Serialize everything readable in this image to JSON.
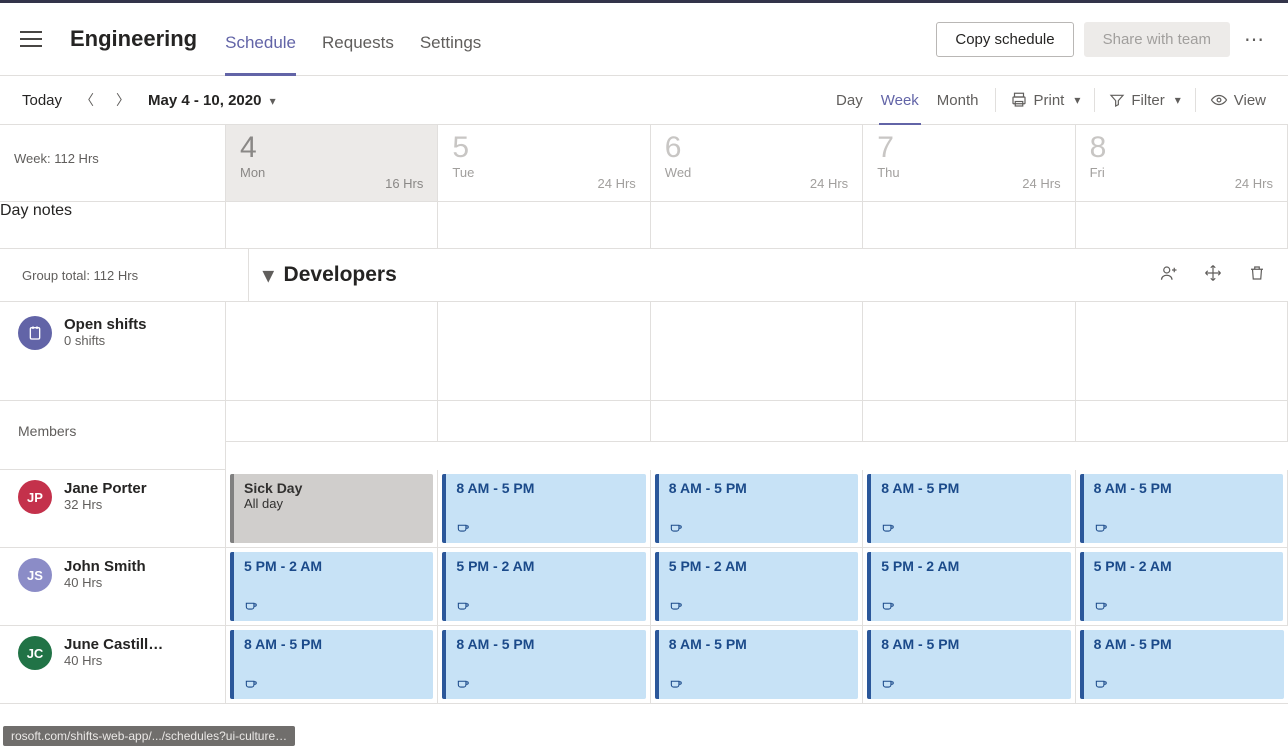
{
  "header": {
    "team": "Engineering",
    "tabs": [
      "Schedule",
      "Requests",
      "Settings"
    ],
    "active_tab": 0,
    "copy": "Copy schedule",
    "share": "Share with team"
  },
  "toolbar": {
    "today": "Today",
    "range": "May 4 - 10, 2020",
    "views": [
      "Day",
      "Week",
      "Month"
    ],
    "active_view": 1,
    "print": "Print",
    "filter": "Filter",
    "view": "View"
  },
  "week_summary": "Week: 112 Hrs",
  "daynotes_label": "Day notes",
  "days": [
    {
      "num": "4",
      "dow": "Mon",
      "hrs": "16 Hrs",
      "today": true
    },
    {
      "num": "5",
      "dow": "Tue",
      "hrs": "24 Hrs",
      "today": false
    },
    {
      "num": "6",
      "dow": "Wed",
      "hrs": "24 Hrs",
      "today": false
    },
    {
      "num": "7",
      "dow": "Thu",
      "hrs": "24 Hrs",
      "today": false
    },
    {
      "num": "8",
      "dow": "Fri",
      "hrs": "24 Hrs",
      "today": false
    }
  ],
  "group": {
    "total": "Group total: 112 Hrs",
    "name": "Developers"
  },
  "open_shifts": {
    "title": "Open shifts",
    "sub": "0 shifts"
  },
  "members_label": "Members",
  "people": [
    {
      "name": "Jane Porter",
      "sub": "32 Hrs",
      "initials": "JP",
      "color": "av-red",
      "shifts": [
        {
          "type": "absence",
          "title": "Sick Day",
          "sub": "All day"
        },
        {
          "type": "shift",
          "title": "8 AM - 5 PM"
        },
        {
          "type": "shift",
          "title": "8 AM - 5 PM"
        },
        {
          "type": "shift",
          "title": "8 AM - 5 PM"
        },
        {
          "type": "shift",
          "title": "8 AM - 5 PM"
        }
      ]
    },
    {
      "name": "John Smith",
      "sub": "40 Hrs",
      "initials": "JS",
      "color": "av-lav",
      "shifts": [
        {
          "type": "shift",
          "title": "5 PM - 2 AM"
        },
        {
          "type": "shift",
          "title": "5 PM - 2 AM"
        },
        {
          "type": "shift",
          "title": "5 PM - 2 AM"
        },
        {
          "type": "shift",
          "title": "5 PM - 2 AM"
        },
        {
          "type": "shift",
          "title": "5 PM - 2 AM"
        }
      ]
    },
    {
      "name": "June Castill…",
      "sub": "40 Hrs",
      "initials": "JC",
      "color": "av-green",
      "shifts": [
        {
          "type": "shift",
          "title": "8 AM - 5 PM"
        },
        {
          "type": "shift",
          "title": "8 AM - 5 PM"
        },
        {
          "type": "shift",
          "title": "8 AM - 5 PM"
        },
        {
          "type": "shift",
          "title": "8 AM - 5 PM"
        },
        {
          "type": "shift",
          "title": "8 AM - 5 PM"
        }
      ]
    }
  ],
  "status_url": "rosoft.com/shifts-web-app/.../schedules?ui-culture…"
}
